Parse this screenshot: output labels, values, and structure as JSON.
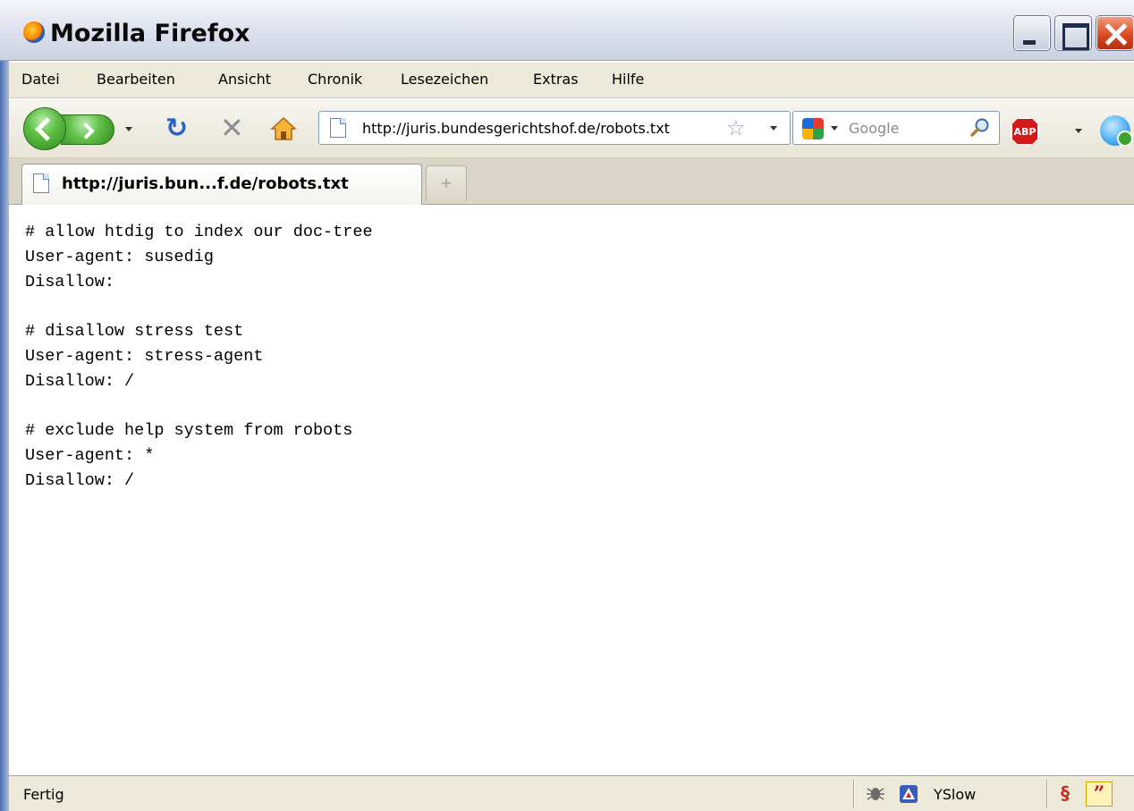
{
  "window": {
    "title": "Mozilla Firefox"
  },
  "menu": {
    "items": [
      {
        "label": "Datei"
      },
      {
        "label": "Bearbeiten"
      },
      {
        "label": "Ansicht"
      },
      {
        "label": "Chronik"
      },
      {
        "label": "Lesezeichen"
      },
      {
        "label": "Extras"
      },
      {
        "label": "Hilfe"
      }
    ]
  },
  "navigation": {
    "url": "http://juris.bundesgerichtshof.de/robots.txt",
    "search_placeholder": "Google"
  },
  "tabs": [
    {
      "label": "http://juris.bun...f.de/robots.txt"
    }
  ],
  "content": {
    "text": "# allow htdig to index our doc-tree\nUser-agent: susedig\nDisallow:\n\n# disallow stress test\nUser-agent: stress-agent\nDisallow: /\n\n# exclude help system from robots\nUser-agent: *\nDisallow: /"
  },
  "statusbar": {
    "status": "Fertig",
    "yslow_label": "YSlow"
  },
  "icons": {
    "browser": "firefox-icon",
    "back": "back-arrow-icon",
    "forward": "forward-arrow-icon",
    "reload": "reload-icon",
    "stop": "stop-icon",
    "home": "home-icon",
    "page": "page-icon",
    "bookmark": "star-icon",
    "search_engine": "google-icon",
    "search": "magnifier-icon",
    "adblock": "adblock-plus-icon",
    "skype": "skype-icon",
    "firebug": "firebug-icon",
    "yslow": "yslow-icon"
  },
  "colors": {
    "accent": "#2a63c6",
    "adblock": "#d21a1a",
    "close": "#d8461f"
  }
}
